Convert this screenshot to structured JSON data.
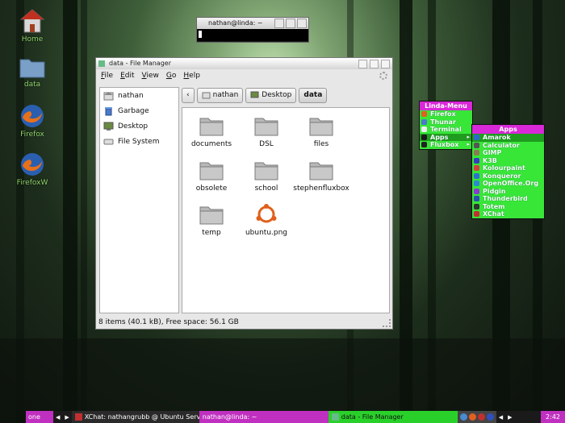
{
  "desktop": {
    "icons": [
      {
        "label": "Home"
      },
      {
        "label": "data"
      },
      {
        "label": "Firefox"
      },
      {
        "label": "FirefoxW"
      }
    ]
  },
  "terminal": {
    "title": "nathan@linda: ~"
  },
  "file_manager": {
    "title": "data - File Manager",
    "menu": [
      {
        "label": "File",
        "key": "F",
        "rest": "ile"
      },
      {
        "label": "Edit",
        "key": "E",
        "rest": "dit"
      },
      {
        "label": "View",
        "key": "V",
        "rest": "iew"
      },
      {
        "label": "Go",
        "key": "G",
        "rest": "o"
      },
      {
        "label": "Help",
        "key": "H",
        "rest": "elp"
      }
    ],
    "sidebar": [
      {
        "label": "nathan",
        "icon": "home-folder-icon"
      },
      {
        "label": "Garbage",
        "icon": "trash-icon"
      },
      {
        "label": "Desktop",
        "icon": "desktop-icon"
      },
      {
        "label": "File System",
        "icon": "drive-icon"
      }
    ],
    "path": [
      {
        "label": "nathan"
      },
      {
        "label": "Desktop"
      },
      {
        "label": "data"
      }
    ],
    "files": [
      {
        "name": "documents",
        "type": "folder"
      },
      {
        "name": "DSL",
        "type": "folder"
      },
      {
        "name": "files",
        "type": "folder"
      },
      {
        "name": "obsolete",
        "type": "folder"
      },
      {
        "name": "school",
        "type": "folder"
      },
      {
        "name": "stephenfluxbox",
        "type": "folder"
      },
      {
        "name": "temp",
        "type": "folder"
      },
      {
        "name": "ubuntu.png",
        "type": "image"
      }
    ],
    "status": "8 items (40.1 kB), Free space: 56.1 GB"
  },
  "linda_menu": {
    "title": "Linda-Menu",
    "items": [
      {
        "label": "Firefox",
        "color": "#e06020"
      },
      {
        "label": "Thunar",
        "color": "#4a7acc"
      },
      {
        "label": "Terminal",
        "color": "#222222"
      },
      {
        "label": "Apps",
        "color": "#1a1a1a"
      },
      {
        "label": "Fluxbox",
        "color": "#222222"
      }
    ]
  },
  "apps_menu": {
    "title": "Apps",
    "items": [
      {
        "label": "Amarok",
        "color": "#2a6ad0"
      },
      {
        "label": "Calculator",
        "color": "#555555"
      },
      {
        "label": "GIMP",
        "color": "#8a7a50"
      },
      {
        "label": "K3B",
        "color": "#3a3ac0"
      },
      {
        "label": "Kolourpaint",
        "color": "#d04040"
      },
      {
        "label": "Konqueror",
        "color": "#2a70d0"
      },
      {
        "label": "OpenOffice.Org",
        "color": "#2a8ad0"
      },
      {
        "label": "Pidgin",
        "color": "#8a3ad0"
      },
      {
        "label": "Thunderbird",
        "color": "#2a50b0"
      },
      {
        "label": "Totem",
        "color": "#333333"
      },
      {
        "label": "XChat",
        "color": "#c03030"
      }
    ]
  },
  "taskbar": {
    "workspace": "one",
    "tasks": [
      {
        "label": "XChat: nathangrubb @ Ubuntu Servers / #"
      },
      {
        "label": "nathan@linda: ~"
      },
      {
        "label": "data - File Manager"
      }
    ],
    "clock": "2:42"
  }
}
